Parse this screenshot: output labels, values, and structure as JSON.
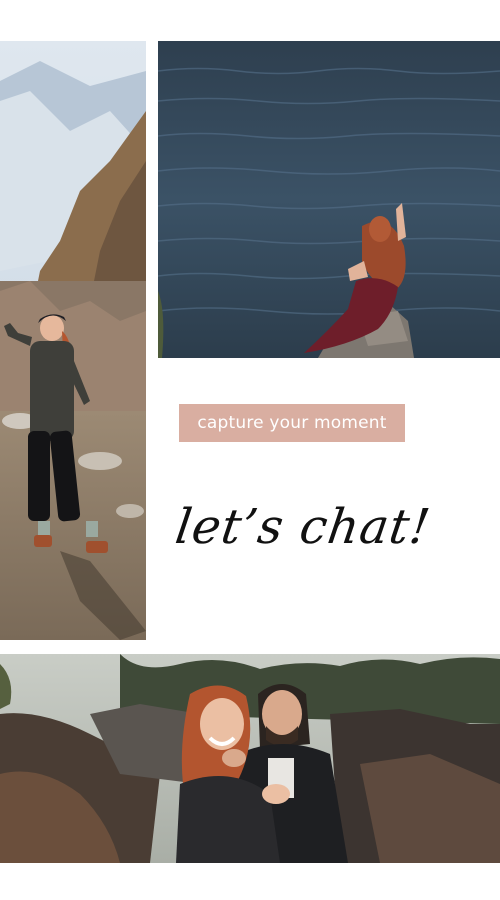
{
  "tagline": "capture your moment",
  "headline": "let’s chat!",
  "colors": {
    "background": "#ffffff",
    "tagline_bg": "#d9aea1",
    "tagline_text": "#ffffff",
    "headline_text": "#111111"
  }
}
